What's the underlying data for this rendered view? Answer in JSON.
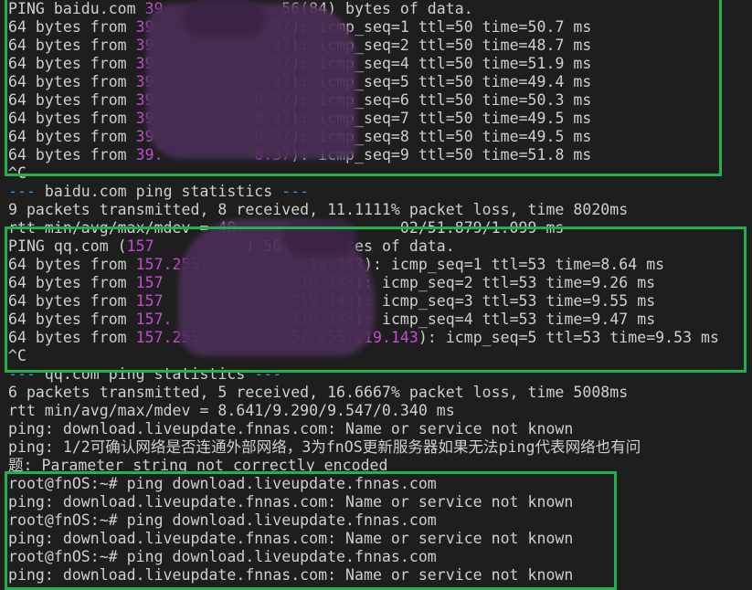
{
  "colors": {
    "background": "#1e1e1e",
    "text": "#cfcfcf",
    "ip": "#c74ad6",
    "stats_dash": "#3a8fd6",
    "highlight_box": "#22b14c"
  },
  "terminal": {
    "lines": [
      {
        "parts": [
          {
            "t": "PING baidu.com "
          },
          {
            "t": "39",
            "c": "ip"
          },
          {
            "t": "             56(84) bytes of data."
          }
        ]
      },
      {
        "parts": [
          {
            "t": "64 bytes from "
          },
          {
            "t": "39",
            "c": "ip"
          },
          {
            "t": "            "
          },
          {
            "t": ".37",
            "c": "ip"
          },
          {
            "t": "): icmp_seq=1 ttl=50 time=50.7 ms"
          }
        ]
      },
      {
        "parts": [
          {
            "t": "64 bytes from "
          },
          {
            "t": "39.",
            "c": "ip"
          },
          {
            "t": "           "
          },
          {
            "t": ".37",
            "c": "ip"
          },
          {
            "t": "): icmp_seq=2 ttl=50 time=48.7 ms"
          }
        ]
      },
      {
        "parts": [
          {
            "t": "64 bytes from "
          },
          {
            "t": "39.",
            "c": "ip"
          },
          {
            "t": "           "
          },
          {
            "t": ".37",
            "c": "ip"
          },
          {
            "t": "): icmp_seq=4 ttl=50 time=51.9 ms"
          }
        ]
      },
      {
        "parts": [
          {
            "t": "64 bytes from "
          },
          {
            "t": "39",
            "c": "ip"
          },
          {
            "t": "            "
          },
          {
            "t": ".37",
            "c": "ip"
          },
          {
            "t": "): icmp_seq=5 ttl=50 time=49.4 ms"
          }
        ]
      },
      {
        "parts": [
          {
            "t": "64 bytes from "
          },
          {
            "t": "39",
            "c": "ip"
          },
          {
            "t": "           "
          },
          {
            "t": "0.37",
            "c": "ip"
          },
          {
            "t": "): icmp_seq=6 ttl=50 time=50.3 ms"
          }
        ]
      },
      {
        "parts": [
          {
            "t": "64 bytes from "
          },
          {
            "t": "39",
            "c": "ip"
          },
          {
            "t": "           "
          },
          {
            "t": "0.37",
            "c": "ip"
          },
          {
            "t": "): icmp_seq=7 ttl=50 time=49.5 ms"
          }
        ]
      },
      {
        "parts": [
          {
            "t": "64 bytes from "
          },
          {
            "t": "39",
            "c": "ip"
          },
          {
            "t": "           "
          },
          {
            "t": "0.37",
            "c": "ip"
          },
          {
            "t": "): icmp_seq=8 ttl=50 time=49.5 ms"
          }
        ]
      },
      {
        "parts": [
          {
            "t": "64 bytes from "
          },
          {
            "t": "39.",
            "c": "ip"
          },
          {
            "t": "          "
          },
          {
            "t": "0.37",
            "c": "ip"
          },
          {
            "t": "): icmp_seq=9 ttl=50 time=51.8 ms"
          }
        ]
      },
      {
        "parts": [
          {
            "t": "^C"
          }
        ]
      },
      {
        "parts": [
          {
            "t": "--- ",
            "c": "dash"
          },
          {
            "t": "baidu.com ping statistics"
          },
          {
            "t": " ---",
            "c": "dash"
          }
        ]
      },
      {
        "parts": [
          {
            "t": "9 packets transmitted, 8 received, 11.1111% packet loss, time 8020ms"
          }
        ]
      },
      {
        "parts": [
          {
            "t": "rtt min/avg/max/mdev = 48.                 02/51.879/1.099 ms"
          }
        ]
      },
      {
        "parts": [
          {
            "t": "PING qq.com ("
          },
          {
            "t": "157",
            "c": "ip"
          },
          {
            "t": "          ) 56(  ) bytes of data."
          }
        ]
      },
      {
        "parts": [
          {
            "t": "64 bytes from "
          },
          {
            "t": "157.255.",
            "c": "ip"
          },
          {
            "t": "           "
          },
          {
            "t": "19.143",
            "c": "ip"
          },
          {
            "t": "): icmp_seq=1 ttl=53 time=8.64 ms"
          }
        ]
      },
      {
        "parts": [
          {
            "t": "64 bytes from "
          },
          {
            "t": "157",
            "c": "ip"
          },
          {
            "t": "               "
          },
          {
            "t": "19.143",
            "c": "ip"
          },
          {
            "t": "): icmp_seq=2 ttl=53 time=9.26 ms"
          }
        ]
      },
      {
        "parts": [
          {
            "t": "64 bytes from "
          },
          {
            "t": "157",
            "c": "ip"
          },
          {
            "t": "              "
          },
          {
            "t": "219.143",
            "c": "ip"
          },
          {
            "t": "): icmp_seq=3 ttl=53 time=9.55 ms"
          }
        ]
      },
      {
        "parts": [
          {
            "t": "64 bytes from "
          },
          {
            "t": "157.",
            "c": "ip"
          },
          {
            "t": "             "
          },
          {
            "t": "219.143",
            "c": "ip"
          },
          {
            "t": "): icmp_seq=4 ttl=53 time=9.47 ms"
          }
        ]
      },
      {
        "parts": [
          {
            "t": "64 bytes from "
          },
          {
            "t": "157.255",
            "c": "ip"
          },
          {
            "t": "          "
          },
          {
            "t": "57.255.219.143",
            "c": "ip"
          },
          {
            "t": "): icmp_seq=5 ttl=53 time=9.53 ms"
          }
        ]
      },
      {
        "parts": [
          {
            "t": "^C"
          }
        ]
      },
      {
        "parts": [
          {
            "t": "--- ",
            "c": "dash"
          },
          {
            "t": "qq.com ping statistics"
          },
          {
            "t": " ---",
            "c": "dash"
          }
        ]
      },
      {
        "parts": [
          {
            "t": "6 packets transmitted, 5 received, 16.6667% packet loss, time 5008ms"
          }
        ]
      },
      {
        "parts": [
          {
            "t": "rtt min/avg/max/mdev = 8.641/9.290/9.547/0.340 ms"
          }
        ]
      },
      {
        "parts": [
          {
            "t": "ping: download.liveupdate.fnnas.com: Name or service not known"
          }
        ]
      },
      {
        "parts": [
          {
            "t": "ping: 1/2可确认网络是否连通外部网络，3为fnOS更新服务器如果无法ping代表网络也有问"
          }
        ]
      },
      {
        "parts": [
          {
            "t": "题: Parameter string not correctly encoded"
          }
        ]
      },
      {
        "parts": [
          {
            "t": "root@fnOS:~# ping download.liveupdate.fnnas.com"
          }
        ]
      },
      {
        "parts": [
          {
            "t": "ping: download.liveupdate.fnnas.com: Name or service not known"
          }
        ]
      },
      {
        "parts": [
          {
            "t": "root@fnOS:~# ping download.liveupdate.fnnas.com"
          }
        ]
      },
      {
        "parts": [
          {
            "t": "ping: download.liveupdate.fnnas.com: Name or service not known"
          }
        ]
      },
      {
        "parts": [
          {
            "t": "root@fnOS:~# ping download.liveupdate.fnnas.com"
          }
        ]
      },
      {
        "parts": [
          {
            "t": "ping: download.liveupdate.fnnas.com: Name or service not known"
          }
        ]
      }
    ]
  }
}
